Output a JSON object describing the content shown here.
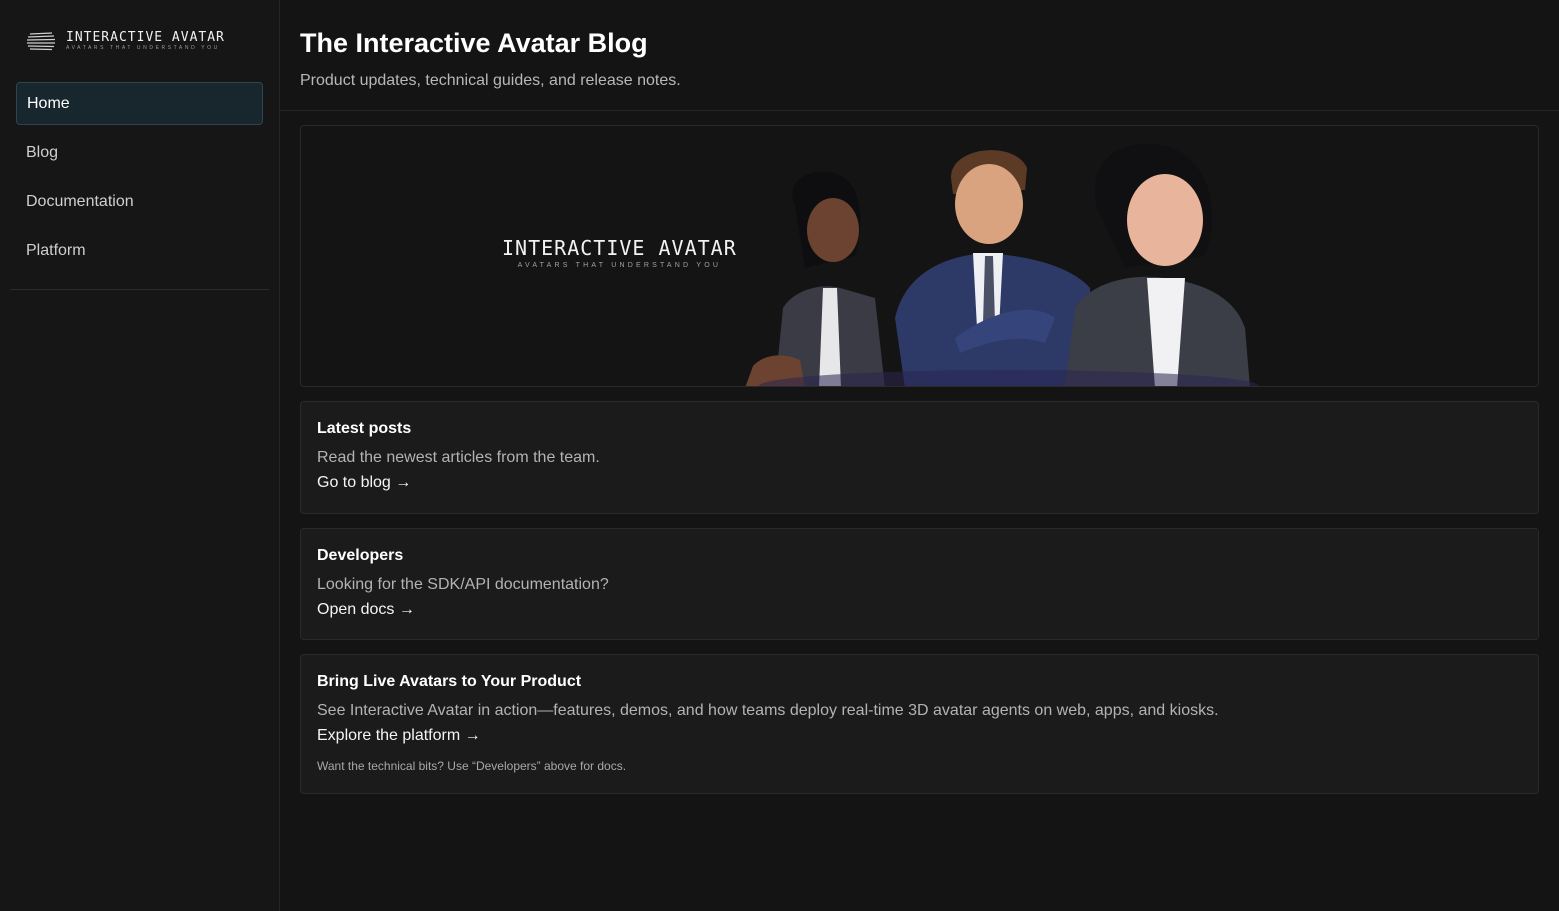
{
  "brand": {
    "title": "INTERACTIVE AVATAR",
    "tagline": "AVATARS THAT UNDERSTAND YOU",
    "icon": "brand-logo-icon"
  },
  "sidebar": {
    "items": [
      {
        "label": "Home",
        "active": true
      },
      {
        "label": "Blog",
        "active": false
      },
      {
        "label": "Documentation",
        "active": false
      },
      {
        "label": "Platform",
        "active": false
      }
    ]
  },
  "header": {
    "title": "The Interactive Avatar Blog",
    "subtitle": "Product updates, technical guides, and release notes."
  },
  "hero": {
    "logo_title": "INTERACTIVE AVATAR",
    "logo_tagline": "AVATARS THAT UNDERSTAND YOU"
  },
  "cards": {
    "posts": {
      "title": "Latest posts",
      "text": "Read the newest articles from the team.",
      "link": "Go to blog →"
    },
    "developers": {
      "title": "Developers",
      "text": "Looking for the SDK/API documentation?",
      "link": "Open docs →"
    },
    "platform": {
      "title": "Bring Live Avatars to Your Product",
      "text": "See Interactive Avatar in action—features, demos, and how teams deploy real-time 3D avatar agents on web, apps, and kiosks.",
      "link": "Explore the platform →",
      "note": "Want the technical bits? Use “Developers” above for docs."
    }
  },
  "colors": {
    "background": "#141414",
    "card": "#1b1b1b",
    "active_nav": "#18262d",
    "active_border": "#2d4553"
  }
}
